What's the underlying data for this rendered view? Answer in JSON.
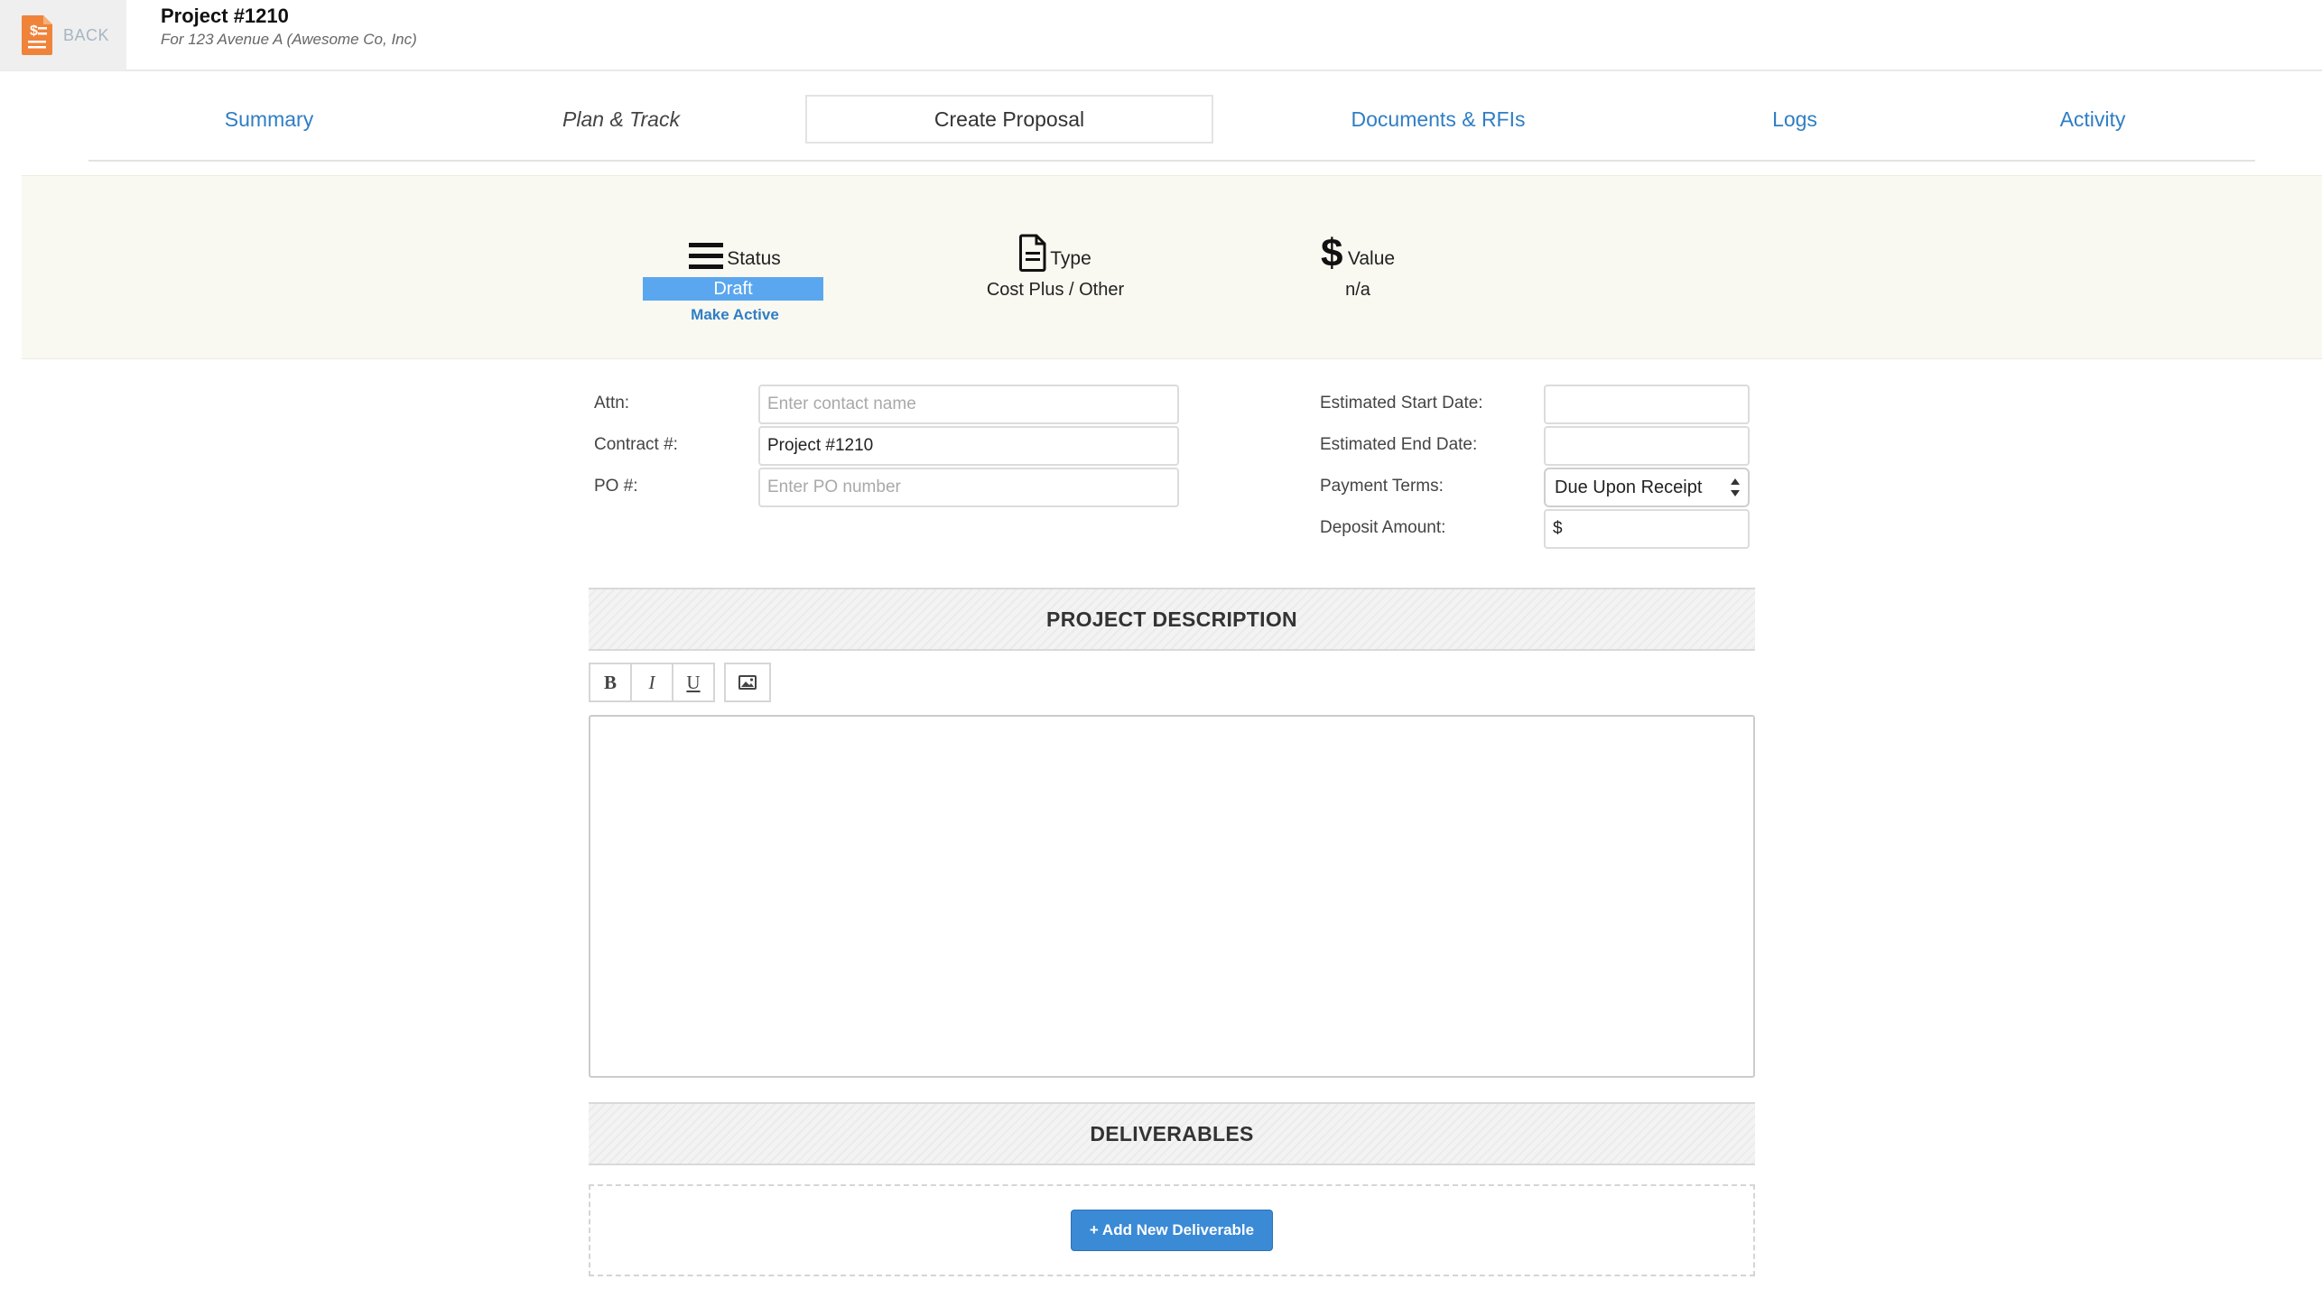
{
  "header": {
    "back_label": "BACK",
    "back_icon": "document-dollar-icon",
    "title": "Project #1210",
    "subtitle": "For 123 Avenue A (Awesome Co, Inc)"
  },
  "tabs": [
    {
      "label": "Summary"
    },
    {
      "label": "Plan & Track"
    },
    {
      "label": "Create Proposal"
    },
    {
      "label": "Documents & RFIs"
    },
    {
      "label": "Logs"
    },
    {
      "label": "Activity"
    }
  ],
  "summary": {
    "status": {
      "icon": "list-icon",
      "label": "Status",
      "value": "Draft",
      "action": "Make Active"
    },
    "type": {
      "icon": "document-icon",
      "label": "Type",
      "value": "Cost Plus / Other"
    },
    "value": {
      "icon": "dollar-icon",
      "label": "Value",
      "value": "n/a"
    }
  },
  "form": {
    "attn": {
      "label": "Attn:",
      "value": "",
      "placeholder": "Enter contact name"
    },
    "contract": {
      "label": "Contract #:",
      "value": "Project #1210",
      "placeholder": ""
    },
    "po": {
      "label": "PO #:",
      "value": "",
      "placeholder": "Enter PO number"
    },
    "start_date": {
      "label": "Estimated Start Date:",
      "value": ""
    },
    "end_date": {
      "label": "Estimated End Date:",
      "value": ""
    },
    "payment_terms": {
      "label": "Payment Terms:",
      "value": "Due Upon Receipt"
    },
    "deposit": {
      "label": "Deposit Amount:",
      "value": "$"
    }
  },
  "description": {
    "heading": "PROJECT DESCRIPTION",
    "toolbar": {
      "bold": "B",
      "italic": "I",
      "underline": "U",
      "image_icon": "image-icon"
    }
  },
  "deliverables": {
    "heading": "DELIVERABLES",
    "add_label": "+ Add New Deliverable"
  },
  "colors": {
    "link": "#2f7ec5",
    "status_badge": "#5aa7ef",
    "primary_button": "#3a8ad6",
    "band": "#f9f9f1",
    "back_icon": "#f0833a"
  }
}
